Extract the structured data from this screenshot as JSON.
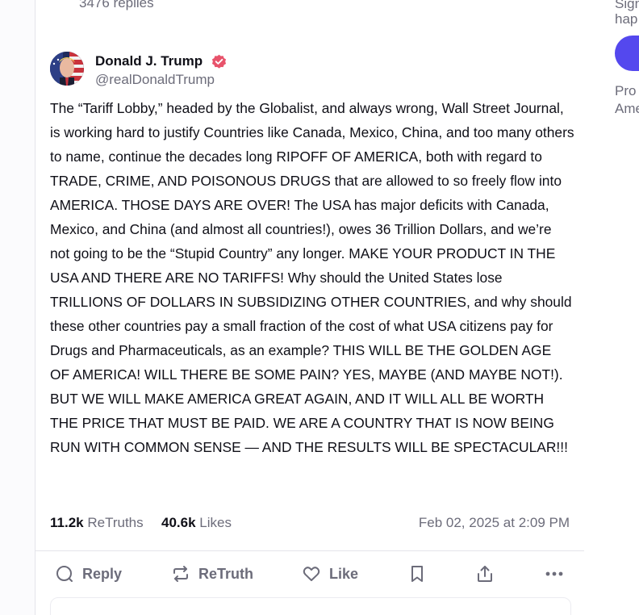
{
  "thread": {
    "replies_count": "3476 replies"
  },
  "post": {
    "author": {
      "display_name": "Donald J. Trump",
      "handle": "@realDonaldTrump",
      "verified": true,
      "avatar_icon": "avatar-flag-icon"
    },
    "body": "The “Tariff Lobby,” headed by the Globalist, and always wrong, Wall Street Journal, is working hard to justify Countries like Canada, Mexico, China, and too many others to name, continue the decades long RIPOFF OF AMERICA, both with regard to TRADE, CRIME, AND POISONOUS DRUGS that are allowed to so freely flow into AMERICA. THOSE DAYS ARE OVER! The USA has major deficits with Canada, Mexico, and China (and almost all countries!), owes 36 Trillion Dollars, and we’re not going to be the “Stupid Country” any longer. MAKE YOUR PRODUCT IN THE USA AND THERE ARE NO TARIFFS! Why should the United States lose TRILLIONS OF DOLLARS IN SUBSIDIZING OTHER COUNTRIES, and why should these other countries pay a small fraction of the cost of what USA citizens pay for Drugs and Pharmaceuticals, as an example? THIS WILL BE THE GOLDEN AGE OF AMERICA! WILL THERE BE SOME PAIN? YES, MAYBE (AND MAYBE NOT!). BUT WE WILL MAKE AMERICA GREAT AGAIN, AND IT WILL ALL BE WORTH THE PRICE THAT MUST BE PAID. WE ARE A COUNTRY THAT IS NOW BEING RUN WITH COMMON SENSE — AND THE RESULTS WILL BE SPECTACULAR!!!",
    "stats": {
      "retruths_count": "11.2k",
      "retruths_label": "ReTruths",
      "likes_count": "40.6k",
      "likes_label": "Likes"
    },
    "timestamp": "Feb 02, 2025 at 2:09 PM"
  },
  "actions": {
    "reply_label": "Reply",
    "retruth_label": "ReTruth",
    "like_label": "Like",
    "icons": [
      "reply-icon",
      "retruth-icon",
      "like-icon",
      "bookmark-icon",
      "share-icon",
      "more-icon"
    ]
  },
  "sidebar": {
    "line1": "Sign",
    "line2": "hap",
    "line3": "Pro",
    "line4": "Ame"
  },
  "colors": {
    "text_primary": "#0f0f17",
    "text_secondary": "#6c6c7a",
    "accent": "#5448ee",
    "verified_badge": "#e8536b",
    "divider": "#e4e4ea"
  }
}
